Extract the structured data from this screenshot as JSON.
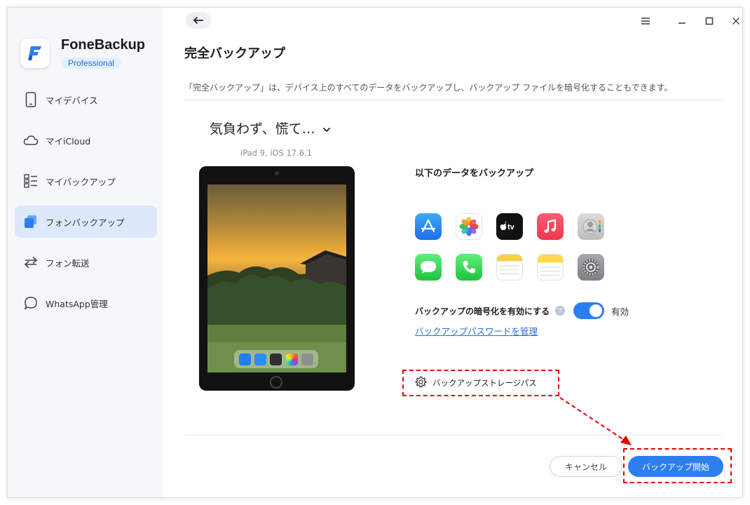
{
  "sidebar": {
    "brand_name": "FoneBackup",
    "brand_badge": "Professional",
    "items": [
      {
        "label": "マイデバイス",
        "icon": "phone-icon"
      },
      {
        "label": "マイiCloud",
        "icon": "cloud-icon"
      },
      {
        "label": "マイバックアップ",
        "icon": "list-icon"
      },
      {
        "label": "フォンバックアップ",
        "icon": "phone-backup-icon",
        "active": true
      },
      {
        "label": "フォン転送",
        "icon": "transfer-icon"
      },
      {
        "label": "WhatsApp管理",
        "icon": "chat-bubble-icon"
      }
    ]
  },
  "main": {
    "title": "完全バックアップ",
    "description": "「完全バックアップ」は、デバイス上のすべてのデータをバックアップし、バックアップ ファイルを暗号化することもできます。",
    "device_name": "気負わず、慌て…",
    "device_model": "iPad 9, iOS 17.6.1",
    "section_title": "以下のデータをバックアップ",
    "apps": [
      "app-store-icon",
      "photos-icon",
      "apple-tv-icon",
      "music-icon",
      "contacts-icon",
      "messages-icon",
      "phone-icon",
      "notes-icon",
      "reminders-notes-icon",
      "settings-icon"
    ],
    "encryption_label": "バックアップの暗号化を有効にする",
    "encryption_help": "?",
    "encryption_state": "有効",
    "password_link": "バックアップパスワードを管理",
    "storage_label": "バックアップストレージパス",
    "cancel_label": "キャンセル",
    "start_label": "バックアップ開始"
  },
  "colors": {
    "accent": "#2d7ff0",
    "annotation": "#e00000",
    "sidebar_bg": "#f6f7f9",
    "active_bg": "#dde9fb"
  }
}
